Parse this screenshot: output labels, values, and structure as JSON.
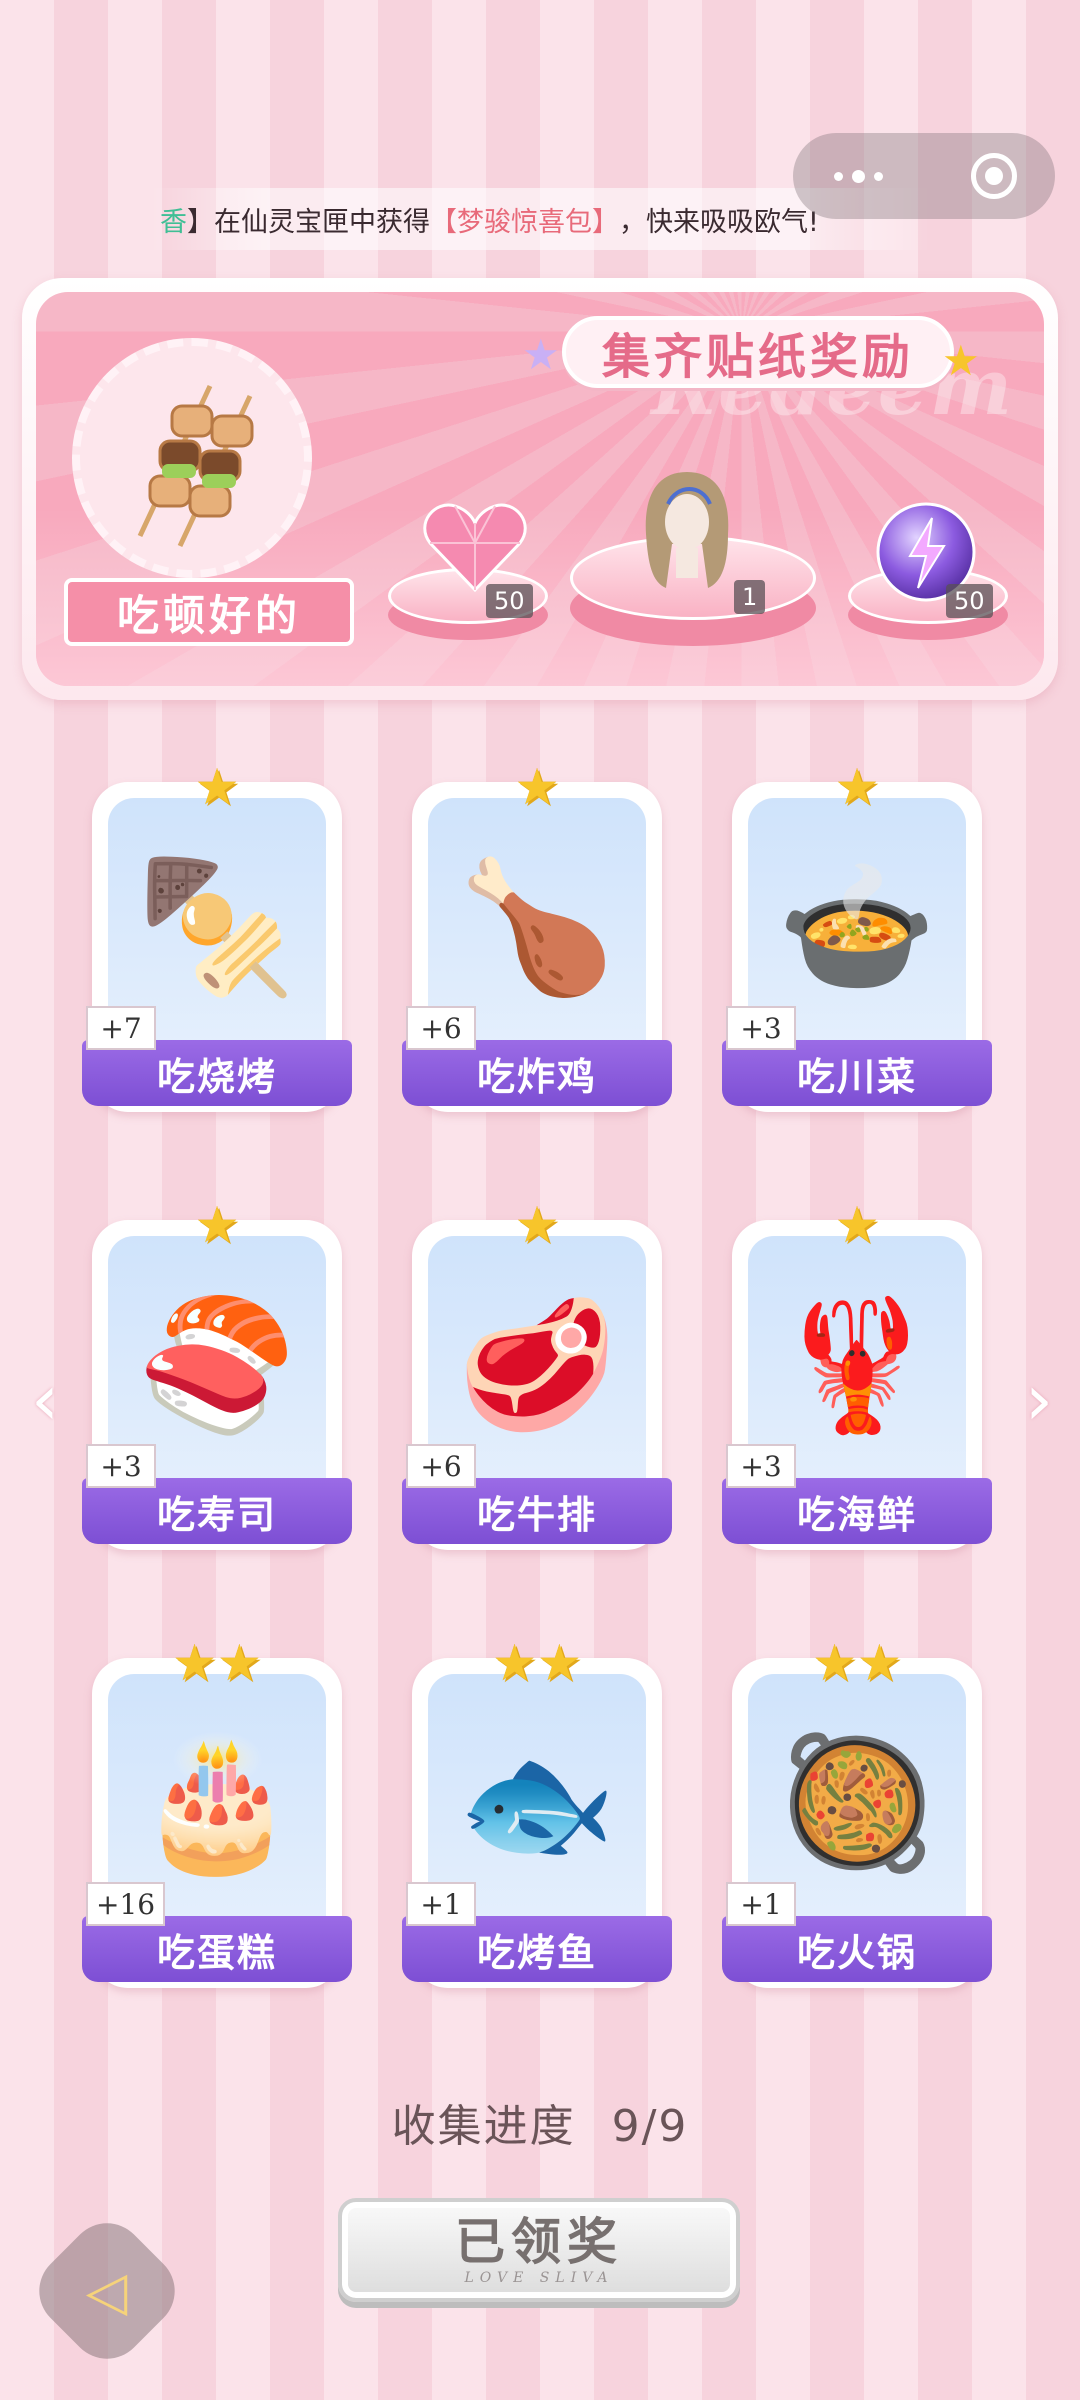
{
  "notice": {
    "user": "香",
    "before": "】在仙灵宝匣中获得",
    "item": "【梦骏惊喜包】",
    "after": "，快来吸吸欧气!"
  },
  "banner": {
    "title": "集齐贴纸奖励",
    "watermark": "Redeem",
    "sticker_name": "吃顿好的",
    "rewards": [
      {
        "icon": "heart-gem",
        "count": "50"
      },
      {
        "icon": "hairstyle",
        "count": "1"
      },
      {
        "icon": "energy-orb",
        "count": "50"
      }
    ]
  },
  "cards": [
    {
      "label": "吃烧烤",
      "count": "+7",
      "stars": "★",
      "icon": "🍢"
    },
    {
      "label": "吃炸鸡",
      "count": "+6",
      "stars": "★",
      "icon": "🍗"
    },
    {
      "label": "吃川菜",
      "count": "+3",
      "stars": "★",
      "icon": "🍲"
    },
    {
      "label": "吃寿司",
      "count": "+3",
      "stars": "★",
      "icon": "🍣"
    },
    {
      "label": "吃牛排",
      "count": "+6",
      "stars": "★",
      "icon": "🥩"
    },
    {
      "label": "吃海鲜",
      "count": "+3",
      "stars": "★",
      "icon": "🦞"
    },
    {
      "label": "吃蛋糕",
      "count": "+16",
      "stars": "★★",
      "icon": "🎂"
    },
    {
      "label": "吃烤鱼",
      "count": "+1",
      "stars": "★★",
      "icon": "🐟"
    },
    {
      "label": "吃火锅",
      "count": "+1",
      "stars": "★★",
      "icon": "🥘"
    }
  ],
  "progress": {
    "label": "收集进度",
    "value": "9/9"
  },
  "claim_button": {
    "label": "已领奖",
    "sub": "LOVE SLIVA"
  },
  "nav": {
    "left": "‹",
    "right": "›"
  },
  "colors": {
    "accent_pink": "#e56b89",
    "label_purple": "#8a5ada",
    "star_gold": "#f7c52b"
  }
}
